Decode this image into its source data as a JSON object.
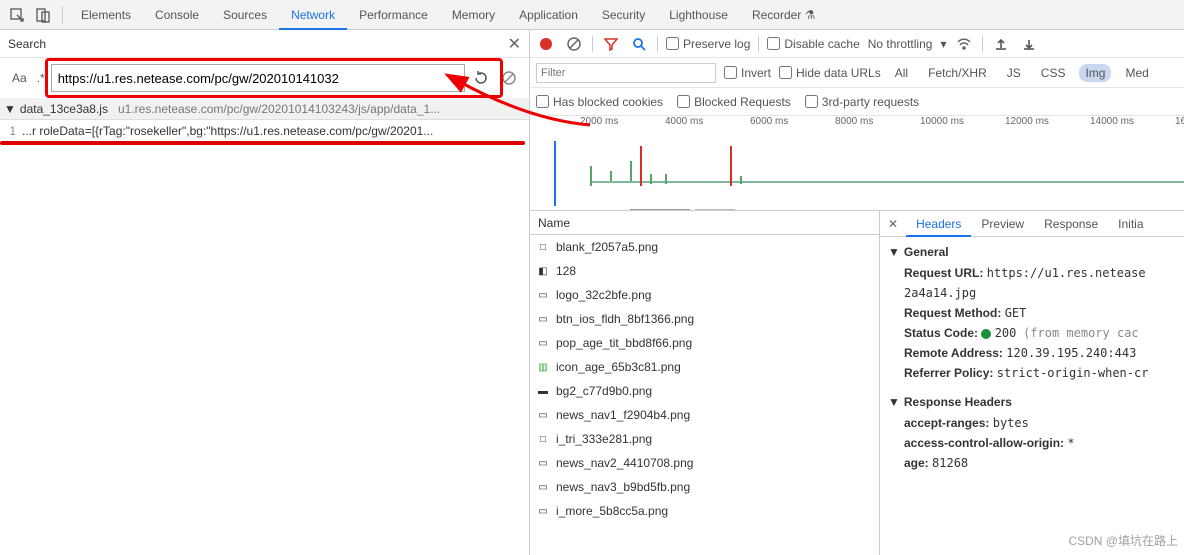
{
  "tabs": {
    "elements": "Elements",
    "console": "Console",
    "sources": "Sources",
    "network": "Network",
    "performance": "Performance",
    "memory": "Memory",
    "application": "Application",
    "security": "Security",
    "lighthouse": "Lighthouse",
    "recorder": "Recorder"
  },
  "search": {
    "title": "Search",
    "aa": "Aa",
    "regex": ".*",
    "value": "https://u1.res.netease.com/pc/gw/202010141032",
    "file_name": "data_13ce3a8.js",
    "file_path": "u1.res.netease.com/pc/gw/20201014103243/js/app/data_1...",
    "result_line": "1",
    "result_text": "...r roleData=[{rTag:\"rosekeller\",bg:\"https://u1.res.netease.com/pc/gw/20201..."
  },
  "net": {
    "preserve": "Preserve log",
    "disable": "Disable cache",
    "throttle": "No throttling",
    "filter_ph": "Filter",
    "invert": "Invert",
    "hide_urls": "Hide data URLs",
    "ft_all": "All",
    "ft_fetch": "Fetch/XHR",
    "ft_js": "JS",
    "ft_css": "CSS",
    "ft_img": "Img",
    "ft_med": "Med",
    "blocked_cookies": "Has blocked cookies",
    "blocked_req": "Blocked Requests",
    "third_party": "3rd-party requests"
  },
  "timeline_labels": [
    "2000 ms",
    "4000 ms",
    "6000 ms",
    "8000 ms",
    "10000 ms",
    "12000 ms",
    "14000 ms",
    "16"
  ],
  "name_header": "Name",
  "files": [
    "blank_f2057a5.png",
    "128",
    "logo_32c2bfe.png",
    "btn_ios_fldh_8bf1366.png",
    "pop_age_tit_bbd8f66.png",
    "icon_age_65b3c81.png",
    "bg2_c77d9b0.png",
    "news_nav1_f2904b4.png",
    "i_tri_333e281.png",
    "news_nav2_4410708.png",
    "news_nav3_b9bd5fb.png",
    "i_more_5b8cc5a.png"
  ],
  "detail": {
    "tab_headers": "Headers",
    "tab_preview": "Preview",
    "tab_response": "Response",
    "tab_init": "Initia",
    "general": "General",
    "req_url_k": "Request URL:",
    "req_url_v": "https://u1.res.netease",
    "req_url_v2": "2a4a14.jpg",
    "req_method_k": "Request Method:",
    "req_method_v": "GET",
    "status_k": "Status Code:",
    "status_v": "200",
    "status_src": "(from memory cac",
    "remote_k": "Remote Address:",
    "remote_v": "120.39.195.240:443",
    "referrer_k": "Referrer Policy:",
    "referrer_v": "strict-origin-when-cr",
    "resp_hd": "Response Headers",
    "ar_k": "accept-ranges:",
    "ar_v": "bytes",
    "acao_k": "access-control-allow-origin:",
    "acao_v": "*",
    "age_k": "age:",
    "age_v": "81268"
  },
  "watermark": "CSDN @填坑在路上"
}
